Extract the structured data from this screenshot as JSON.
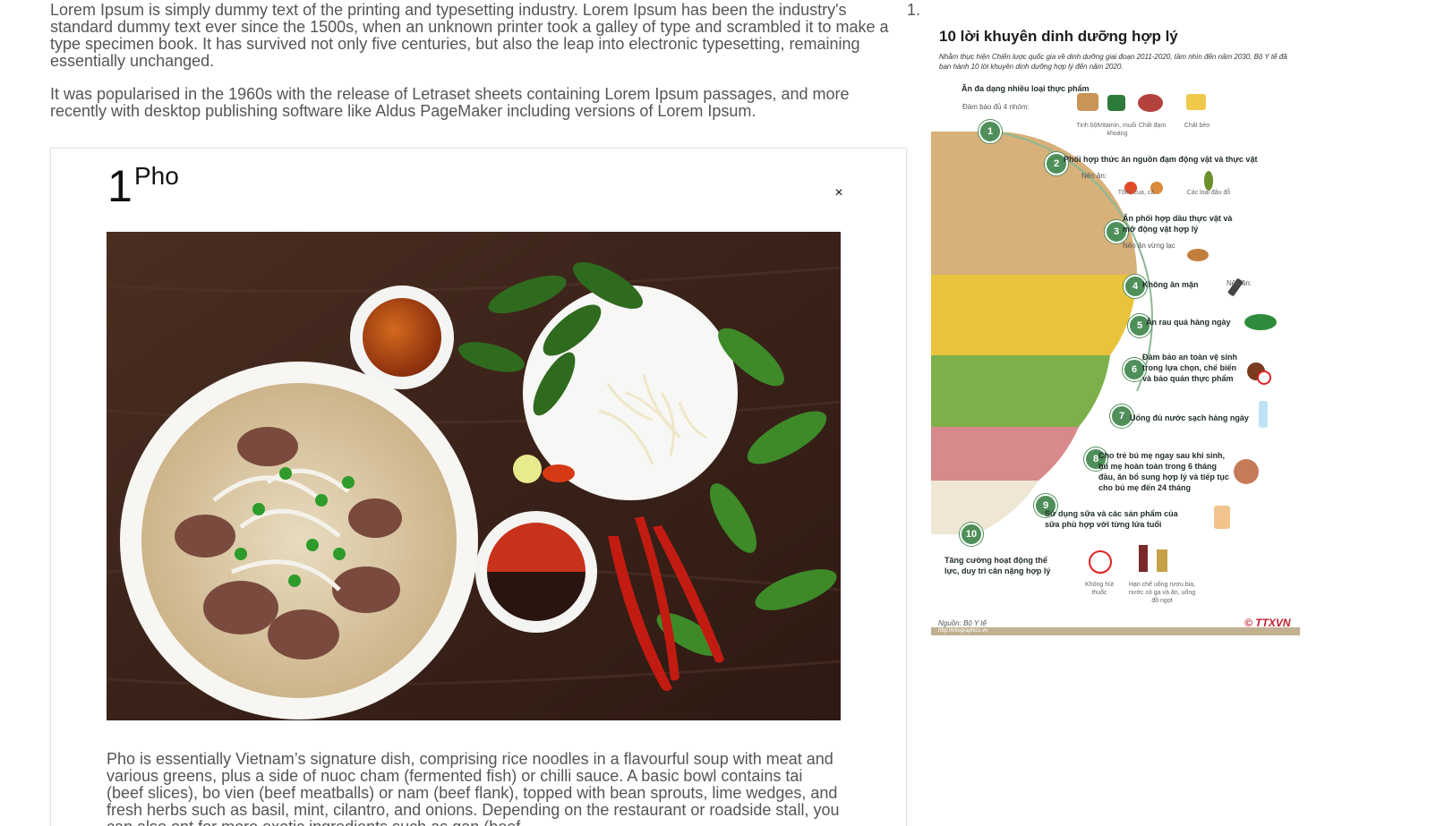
{
  "intro": {
    "paragraph1": "Lorem Ipsum is simply dummy text of the printing and typesetting industry. Lorem Ipsum has been the industry's standard dummy text ever since the 1500s, when an unknown printer took a galley of type and scrambled it to make a type specimen book. It has survived not only five centuries, but also the leap into electronic typesetting, remaining essentially unchanged.",
    "paragraph2": "It was popularised in the 1960s with the release of Letraset sheets containing Lorem Ipsum passages, and more recently with desktop publishing software like Aldus PageMaker including versions of Lorem Ipsum.",
    "list_marker": "1."
  },
  "card": {
    "number": "1",
    "title": "Pho",
    "close_label": "×",
    "photo_icon": "pho-bowl-photo",
    "description": "Pho is essentially Vietnam’s signature dish, comprising rice noodles in a flavourful soup with meat and various greens, plus a side of nuoc cham (fermented fish) or chilli sauce. A basic bowl contains tai (beef slices), bo vien (beef meatballs) or nam (beef flank), topped with bean sprouts, lime wedges, and fresh herbs such as basil, mint, cilantro, and onions. Depending on the restaurant or roadside stall, you can also opt for more exotic ingredients such as gan (beef"
  },
  "infographic": {
    "title": "10 lời khuyên dinh dưỡng hợp lý",
    "subtitle": "Nhằm thực hiện Chiến lược quốc gia về dinh dưỡng giai đoạn 2011-2020, tầm nhìn đến năm 2030, Bộ Y tế đã ban hành 10 lời khuyên dinh dưỡng hợp lý đến năm 2020.",
    "tips": [
      {
        "number": "1",
        "text": "Ăn đa dạng nhiều loại thực phẩm"
      },
      {
        "number": "2",
        "text": "Phối hợp thức ăn nguồn đạm động vật và thực vật"
      },
      {
        "number": "3",
        "text": "Ăn phối hợp dầu thực vật và mỡ động vật hợp lý"
      },
      {
        "number": "4",
        "text": "Không ăn mặn"
      },
      {
        "number": "5",
        "text": "Ăn rau quả hàng ngày"
      },
      {
        "number": "6",
        "text": "Đảm bảo an toàn vệ sinh trong lựa chọn, chế biến và bảo quản thực phẩm"
      },
      {
        "number": "7",
        "text": "Uống đủ nước sạch hàng ngày"
      },
      {
        "number": "8",
        "text": "Cho trẻ bú mẹ ngay sau khi sinh, bú mẹ hoàn toàn trong 6 tháng đầu, ăn bổ sung hợp lý và tiếp tục cho bú mẹ đến 24 tháng"
      },
      {
        "number": "9",
        "text": "Sử dụng sữa và các sản phẩm của sữa phù hợp với từng lứa tuổi"
      },
      {
        "number": "10",
        "text": "Tăng cường hoạt động thể lực, duy trì cân nặng hợp lý"
      }
    ],
    "sub_labels": {
      "four_groups": "Đảm bảo đủ 4 nhóm:",
      "starch": "Tinh bột",
      "vitamins": "Vitamin, muối khoáng",
      "protein": "Chất đạm",
      "fat": "Chất béo",
      "should_eat": "Nên ăn:",
      "seafood": "Tôm, cua, cá",
      "beans": "Các loại đậu đỗ",
      "sesame": "Nên ăn vừng lạc",
      "salt_should": "Nên ăn:",
      "no_smoking": "Không hút thuốc",
      "limit_drinks": "Hạn chế uống rượu bia, nước có ga và ăn, uống đồ ngọt"
    },
    "source": "Nguồn: Bộ Y tế",
    "logo": "© TTXVN",
    "footer_url": "http://infographics.vn",
    "colors": {
      "badge": "#4f8f5a",
      "accent_red": "#c01e2e",
      "footer": "#c2b092"
    }
  }
}
